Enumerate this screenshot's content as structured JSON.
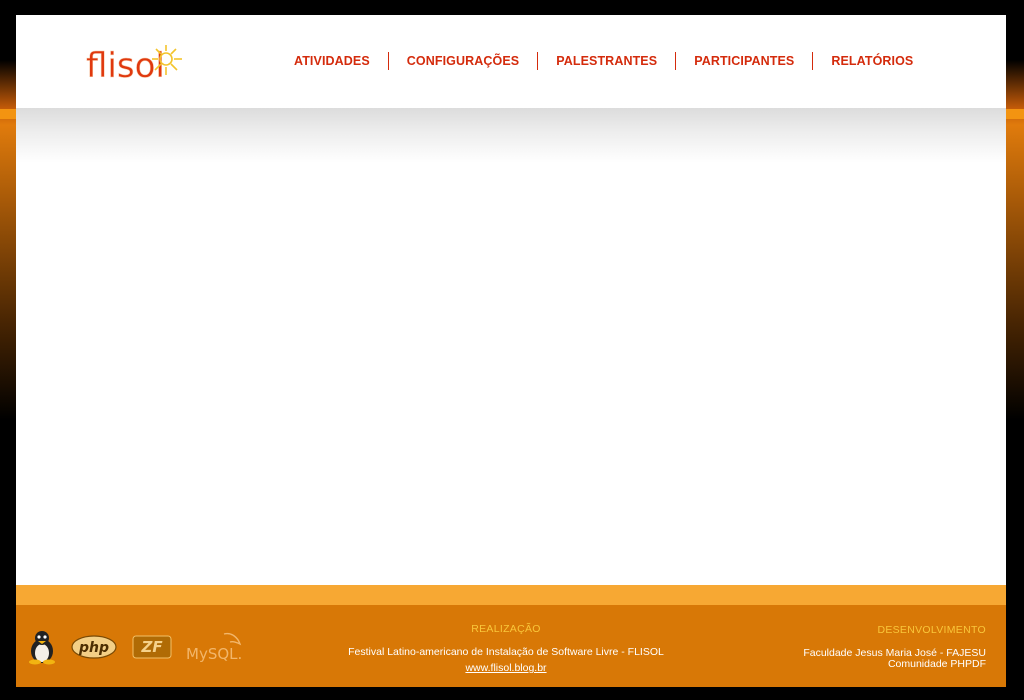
{
  "header": {
    "logo_text": "flisol",
    "nav": [
      {
        "label": "ATIVIDADES"
      },
      {
        "label": "CONFIGURAÇÕES"
      },
      {
        "label": "PALESTRANTES"
      },
      {
        "label": "PARTICIPANTES"
      },
      {
        "label": "RELATÓRIOS"
      }
    ]
  },
  "footer": {
    "realizacao": {
      "heading": "REALIZAÇÃO",
      "text": "Festival Latino-americano de Instalação de Software Livre - FLISOL",
      "link": "www.flisol.blog.br"
    },
    "desenvolvimento": {
      "heading": "DESENVOLVIMENTO",
      "line1": "Faculdade Jesus Maria José - FAJESU",
      "line2": "Comunidade PHPDF"
    },
    "tech_logos": {
      "php": "php",
      "zf": "ZF",
      "mysql": "MySQL."
    }
  },
  "colors": {
    "nav_text": "#d42b0c",
    "footer_bg": "#d87806",
    "footer_band": "#f7a833",
    "footer_heading": "#f9c63a"
  }
}
